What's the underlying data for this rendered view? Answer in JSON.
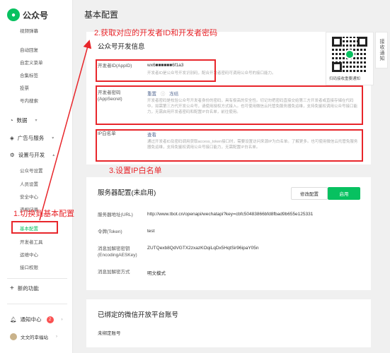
{
  "app": {
    "logo_text": "公众号"
  },
  "sidebar": {
    "items_top": [
      "视频弹幕",
      "自动回复",
      "自定义菜单",
      "合集标签",
      "投票",
      "号内搜索"
    ],
    "group_data": "数据",
    "group_ads": "广告与服务",
    "group_settings": "设置与开发",
    "settings_items": [
      "公众号设置",
      "人员设置",
      "安全中心",
      "违规记录",
      "基本配置",
      "开发者工具",
      "运维中心",
      "接口权限"
    ],
    "new_feature": "新的功能",
    "notifications": "通知中心",
    "notifications_count": "2",
    "account_name": "文文的幸福站"
  },
  "header": {
    "title": "基本配置"
  },
  "dev_info": {
    "title": "公众号开发信息",
    "appid_label": "开发者ID(AppID)",
    "appid_value": "wx6■■■■■■6f1a3",
    "appid_desc": "开发者ID是公众号开发识别码，配合开发者密码可调用公众号的接口能力。",
    "secret_label": "开发者密码(AppSecret)",
    "secret_reset": "重置",
    "secret_enable": "冻结",
    "secret_desc": "开发者密码是校验公众号开发者身份的密码，具有极高的安全性。切记勿把密码直接交给第三方开发者或直接存储在代码中。如需第三方代开发公众号，请使用授权方式接入。也可使用微信云托管免服务器免运维，支持免鉴权调用公众号接口能力，无需启用开发者密码和配置IP白名单，前往使用。",
    "ip_label": "IP白名单",
    "ip_view": "查看",
    "ip_desc": "通过开发者ID及密码调用获取access_token接口时，需要设置访问来源IP为白名单。了解更多。也可使用微信云托管免服务器免运维，支持免鉴权调用公众号接口能力，无需配置IP白名单。"
  },
  "server": {
    "title": "服务器配置(未启用)",
    "modify_btn": "修改配置",
    "enable_btn": "启用",
    "url_label": "服务器地址(URL)",
    "url_value": "http://www.tbot.cn/openapi/wechatapi?key=cbfc50483866bfd8fbad9b655e125331",
    "token_label": "令牌(Token)",
    "token_value": "test",
    "aes_label": "消息加解密密钥(EncodingAESKey)",
    "aes_value": "ZUTQexb8QdVGTX2zxazKOqiLqDx5HqtSir96ipaY05n",
    "mode_label": "消息加解密方式",
    "mode_value": "明文模式"
  },
  "bound": {
    "title": "已绑定的微信开放平台账号",
    "empty": "未绑定账号"
  },
  "qr": {
    "caption": "扫码接收重要通知",
    "tab": "接收通知"
  },
  "annotations": {
    "step1": "1.切换到基本配置",
    "step2": "2.获取对应的开发者ID和开发者密码",
    "step3": "3.设置IP白名单"
  },
  "colors": {
    "accent": "#07c160",
    "annotation": "#e8262b",
    "link": "#576b95"
  }
}
